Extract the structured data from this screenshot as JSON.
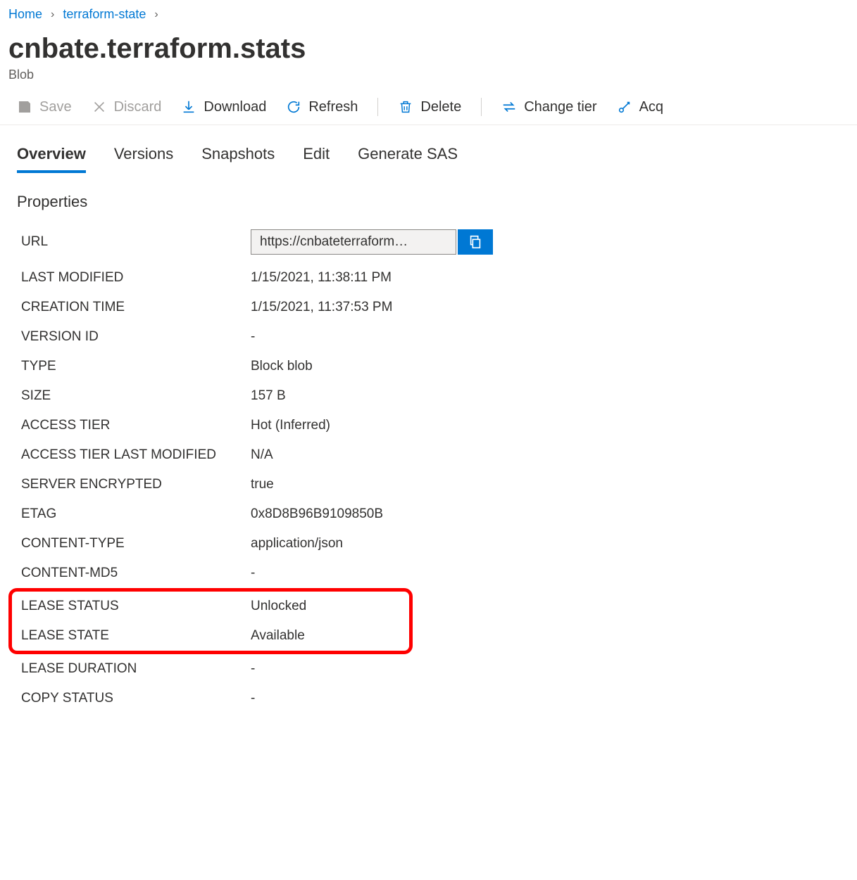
{
  "breadcrumb": {
    "home": "Home",
    "parent": "terraform-state"
  },
  "title": "cnbate.terraform.stats",
  "subtitle": "Blob",
  "toolbar": {
    "save": "Save",
    "discard": "Discard",
    "download": "Download",
    "refresh": "Refresh",
    "delete": "Delete",
    "change_tier": "Change tier",
    "acquire": "Acq"
  },
  "tabs": {
    "overview": "Overview",
    "versions": "Versions",
    "snapshots": "Snapshots",
    "edit": "Edit",
    "generate_sas": "Generate SAS"
  },
  "section_title": "Properties",
  "properties": {
    "url_label": "URL",
    "url_value": "https://cnbateterraform…",
    "last_modified_label": "LAST MODIFIED",
    "last_modified_value": "1/15/2021, 11:38:11 PM",
    "creation_time_label": "CREATION TIME",
    "creation_time_value": "1/15/2021, 11:37:53 PM",
    "version_id_label": "VERSION ID",
    "version_id_value": "-",
    "type_label": "TYPE",
    "type_value": "Block blob",
    "size_label": "SIZE",
    "size_value": "157 B",
    "access_tier_label": "ACCESS TIER",
    "access_tier_value": "Hot (Inferred)",
    "access_tier_last_modified_label": "ACCESS TIER LAST MODIFIED",
    "access_tier_last_modified_value": "N/A",
    "server_encrypted_label": "SERVER ENCRYPTED",
    "server_encrypted_value": "true",
    "etag_label": "ETAG",
    "etag_value": "0x8D8B96B9109850B",
    "content_type_label": "CONTENT-TYPE",
    "content_type_value": "application/json",
    "content_md5_label": "CONTENT-MD5",
    "content_md5_value": "-",
    "lease_status_label": "LEASE STATUS",
    "lease_status_value": "Unlocked",
    "lease_state_label": "LEASE STATE",
    "lease_state_value": "Available",
    "lease_duration_label": "LEASE DURATION",
    "lease_duration_value": "-",
    "copy_status_label": "COPY STATUS",
    "copy_status_value": "-"
  }
}
